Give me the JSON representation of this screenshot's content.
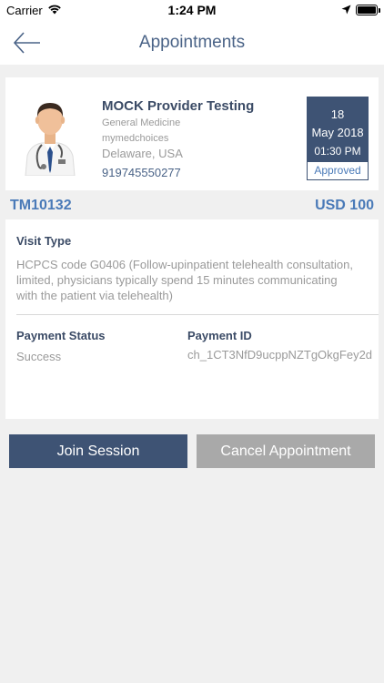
{
  "status_bar": {
    "carrier": "Carrier",
    "time": "1:24 PM",
    "icons": [
      "wifi-icon",
      "location-icon",
      "battery-icon"
    ]
  },
  "nav": {
    "title": "Appointments",
    "back_icon": "back-arrow-icon"
  },
  "provider": {
    "name": "MOCK Provider Testing",
    "specialty": "General Medicine",
    "organization": "mymedchoices",
    "location": "Delaware, USA",
    "phone": "919745550277",
    "avatar_icon": "doctor-avatar-icon"
  },
  "appointment": {
    "day": "18",
    "month_year": "May 2018",
    "time": "01:30 PM",
    "status": "Approved",
    "id": "TM10132",
    "price": "USD 100"
  },
  "visit": {
    "type_label": "Visit Type",
    "type_value": "HCPCS code G0406 (Follow-upinpatient telehealth consultation, limited, physicians typically spend 15 minutes communicating with the patient via telehealth)"
  },
  "payment": {
    "status_label": "Payment Status",
    "status_value": "Success",
    "id_label": "Payment ID",
    "id_value": "ch_1CT3NfD9ucppNZTgOkgFey2d"
  },
  "actions": {
    "join_label": "Join Session",
    "cancel_label": "Cancel Appointment"
  },
  "colors": {
    "primary": "#3e5374",
    "accent": "#4a7ab8",
    "disabled": "#a9a9a9",
    "background": "#f0f0f0"
  }
}
